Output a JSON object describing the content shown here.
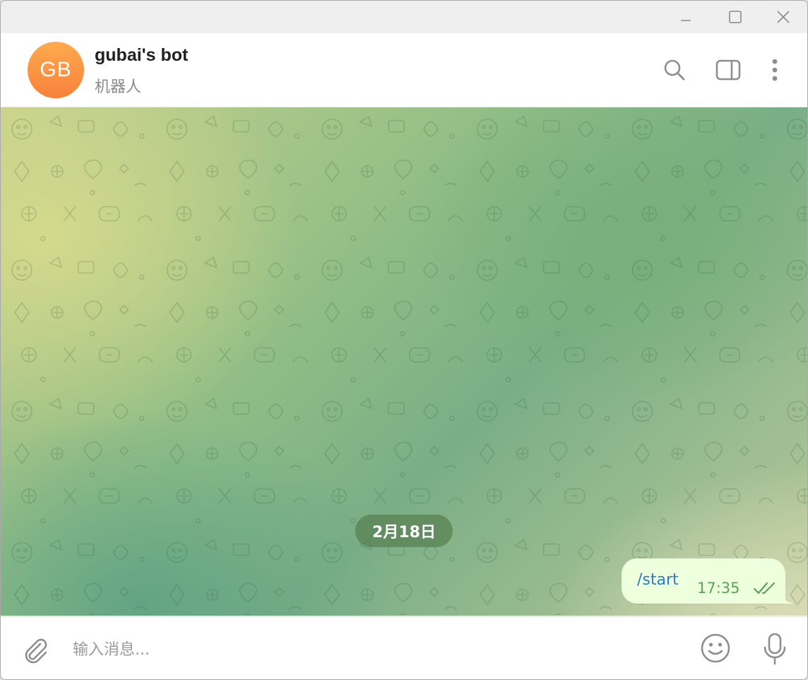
{
  "window": {
    "controls": {
      "minimize_icon": "minimize-icon",
      "maximize_icon": "maximize-icon",
      "close_icon": "close-icon"
    }
  },
  "header": {
    "avatar_initials": "GB",
    "title": "gubai's bot",
    "subtitle": "机器人",
    "actions": [
      "search-icon",
      "sidebar-toggle-icon",
      "more-vertical-icon"
    ]
  },
  "chat": {
    "date_separator": "2月18日",
    "messages": [
      {
        "text": "/start",
        "time": "17:35",
        "status": "double-check-icon",
        "outgoing": true
      }
    ]
  },
  "composer": {
    "placeholder": "输入消息...",
    "value": ""
  },
  "colors": {
    "avatar_top": "#ffaa4e",
    "avatar_bottom": "#f7813a",
    "outgoing_bubble": "#eeffde",
    "message_link": "#2a7ec5",
    "message_meta": "#58a559",
    "date_pill": "#588050"
  }
}
